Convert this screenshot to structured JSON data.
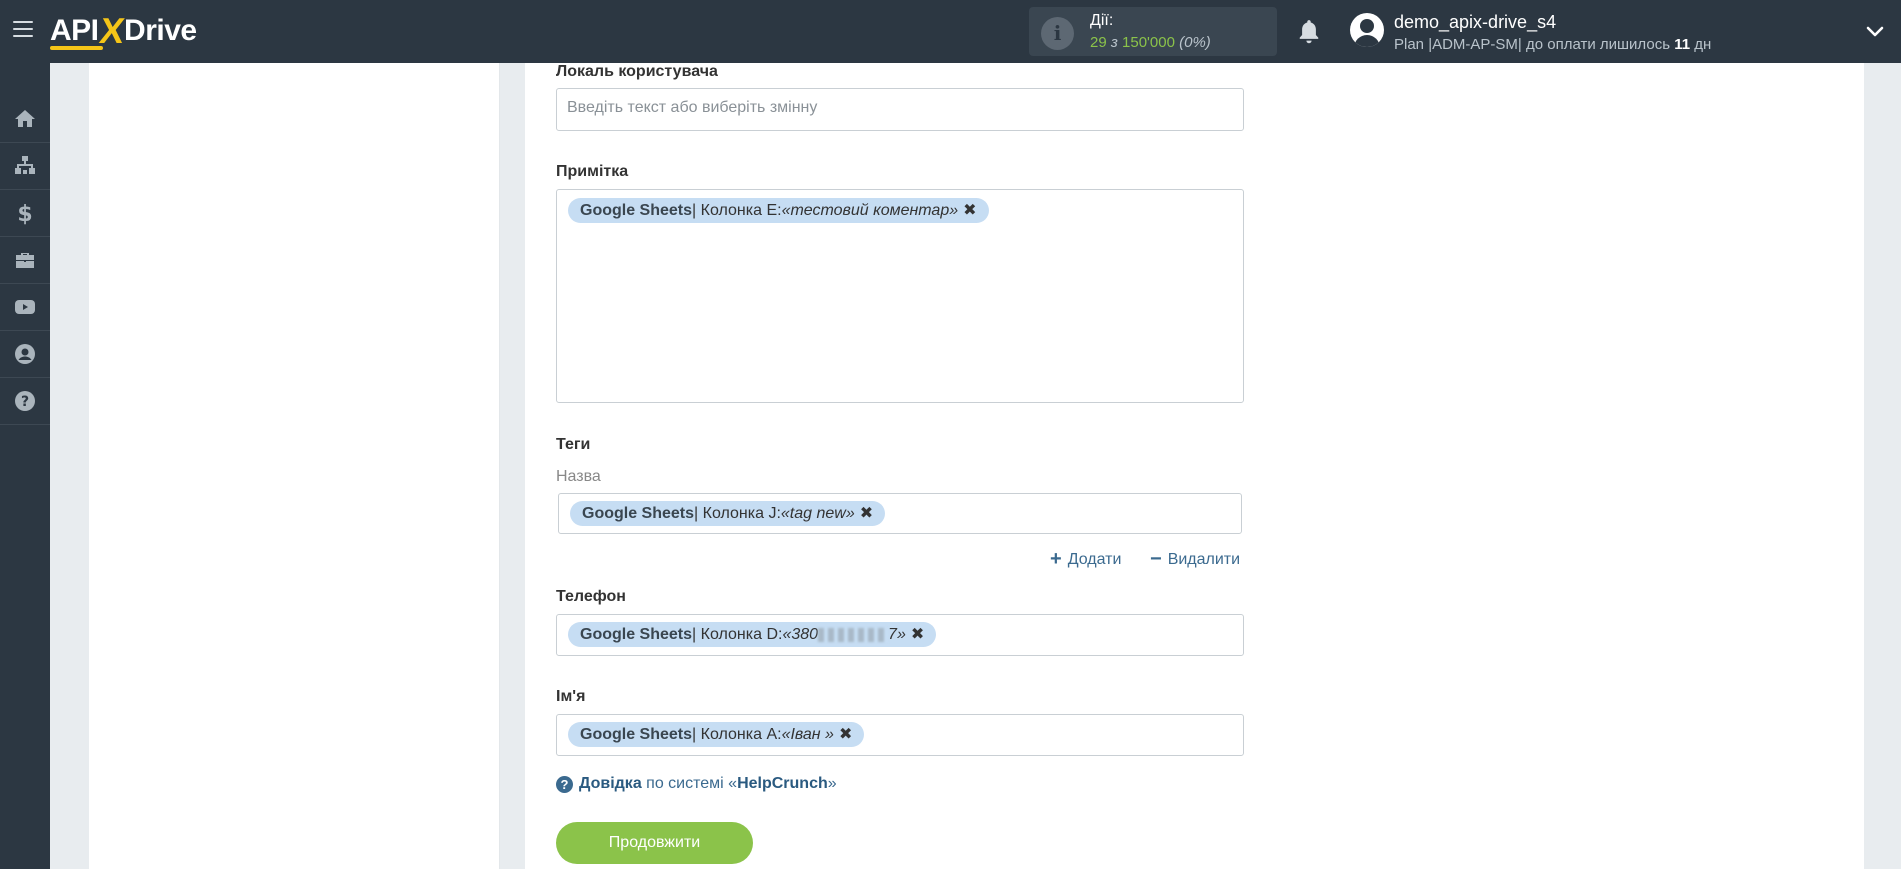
{
  "header": {
    "actions_label": "Дії:",
    "actions_used": "29",
    "actions_of": "з",
    "actions_total": "150'000",
    "actions_pct": "(0%)",
    "user_name": "demo_apix-drive_s4",
    "plan_prefix": "Plan |ADM-AP-SM| до оплати лишилось ",
    "plan_days": "11",
    "plan_suffix": " дн"
  },
  "logo": {
    "api": "API",
    "x": "X",
    "drive": "Drive"
  },
  "fields": {
    "locale": {
      "label": "Локаль користувача",
      "placeholder": "Введіть текст або виберіть змінну"
    },
    "note": {
      "label": "Примітка",
      "tag_source": "Google Sheets",
      "tag_column": " | Колонка E: ",
      "tag_value": "«тестовий коментар»"
    },
    "tags": {
      "label": "Теги",
      "sublabel": "Назва",
      "tag_source": "Google Sheets",
      "tag_column": " | Колонка J: ",
      "tag_value": "«tag new»",
      "add": "Додати",
      "remove": "Видалити"
    },
    "phone": {
      "label": "Телефон",
      "tag_source": "Google Sheets",
      "tag_column": " | Колонка D: ",
      "tag_value_start": "«380",
      "tag_value_end": "7»"
    },
    "name": {
      "label": "Ім'я",
      "tag_source": "Google Sheets",
      "tag_column": " | Колонка A: ",
      "tag_value": "«Іван »"
    }
  },
  "help": {
    "link": "Довідка",
    "text": " по системі «",
    "system": "HelpCrunch",
    "end": "»"
  },
  "continue_label": "Продовжити",
  "icons": [
    "menu-icon",
    "bell-icon",
    "info-icon",
    "user-icon",
    "chevron-down-icon",
    "home-icon",
    "sitemap-icon",
    "dollar-icon",
    "briefcase-icon",
    "youtube-icon",
    "account-icon",
    "help-icon"
  ]
}
